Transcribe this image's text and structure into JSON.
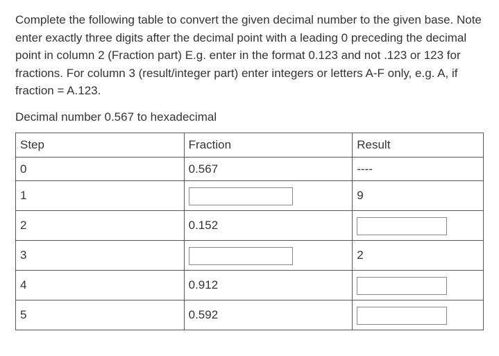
{
  "instructions": "Complete the following table to convert the given decimal number to the given base. Note enter exactly three digits after the decimal point with a leading 0 preceding the decimal point in column 2 (Fraction part)  E.g. enter in the format 0.123 and not .123 or 123 for fractions. For column 3 (result/integer part) enter integers or letters A-F only, e.g. A, if fraction = A.123.",
  "subtitle": "Decimal number 0.567 to hexadecimal",
  "headers": {
    "step": "Step",
    "fraction": "Fraction",
    "result": "Result"
  },
  "rows": [
    {
      "step": "0",
      "fraction_text": "0.567",
      "result_text": "----"
    },
    {
      "step": "1",
      "fraction_input": "",
      "result_text": "9"
    },
    {
      "step": "2",
      "fraction_text": "0.152",
      "result_input": ""
    },
    {
      "step": "3",
      "fraction_input": "",
      "result_text": "2"
    },
    {
      "step": "4",
      "fraction_text": "0.912",
      "result_input": ""
    },
    {
      "step": "5",
      "fraction_text": "0.592",
      "result_input": ""
    }
  ]
}
